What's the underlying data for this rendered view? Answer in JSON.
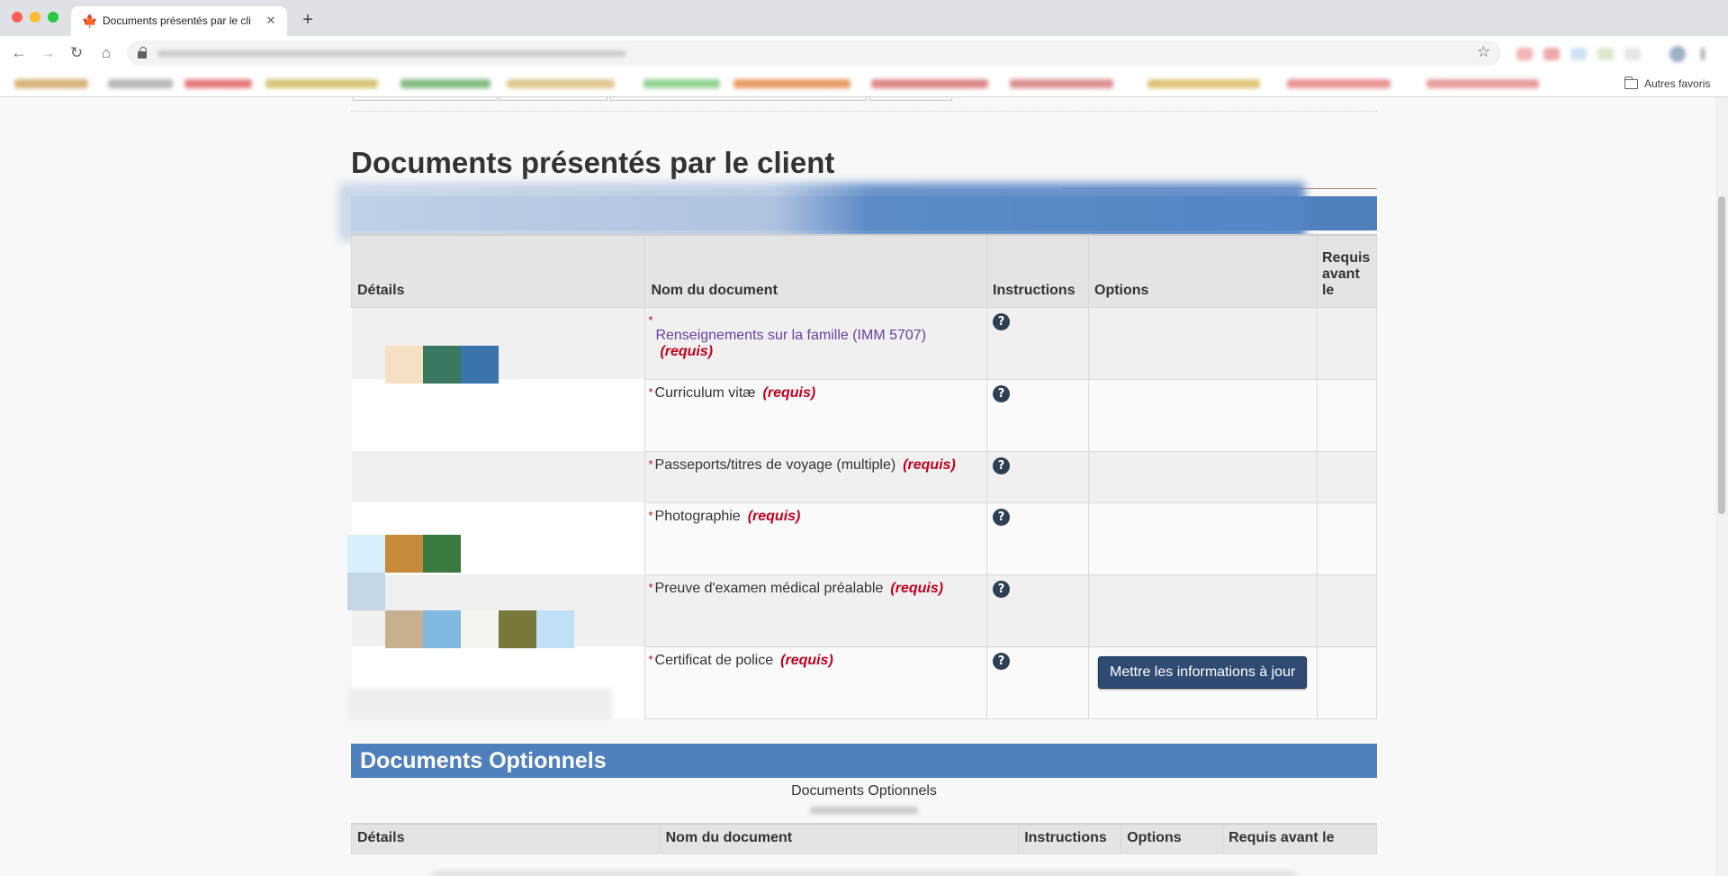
{
  "browser": {
    "tab_title": "Documents présentés par le cli",
    "tab_close": "✕",
    "new_tab": "+",
    "bookmarks_other": "Autres favoris"
  },
  "main": {
    "section_title": "Documents présentés par le client",
    "table": {
      "headers": {
        "details": "Détails",
        "name": "Nom du document",
        "instructions": "Instructions",
        "options": "Options",
        "required_before": "Requis avant le"
      },
      "rows": [
        {
          "star": "*",
          "name": "Renseignements sur la famille (IMM 5707)",
          "required": "(requis)",
          "help": "?",
          "is_link": true
        },
        {
          "star": "*",
          "name": "Curriculum vitæ",
          "required": "(requis)",
          "help": "?"
        },
        {
          "star": "*",
          "name": "Passeports/titres de voyage (multiple)",
          "required": "(requis)",
          "help": "?"
        },
        {
          "star": "*",
          "name": "Photographie",
          "required": "(requis)",
          "help": "?"
        },
        {
          "star": "*",
          "name": "Preuve d'examen médical préalable",
          "required": "(requis)",
          "help": "?"
        },
        {
          "star": "*",
          "name": "Certificat de police",
          "required": "(requis)",
          "help": "?",
          "option_button": "Mettre les informations à jour"
        }
      ]
    }
  },
  "optional": {
    "band_title": "Documents Optionnels",
    "caption": "Documents Optionnels",
    "table": {
      "headers": {
        "details": "Détails",
        "name": "Nom du document",
        "instructions": "Instructions",
        "options": "Options",
        "required_before": "Requis avant le"
      }
    }
  },
  "colors": {
    "band_blue": "#4f7fbd",
    "button_navy": "#2f4b73",
    "required_red": "#c00020",
    "link_purple": "#6a3fa0",
    "pixel_tiles": [
      "#f6e0c4",
      "#3a7860",
      "#3a73ad",
      "#d6effa",
      "#c58a3c",
      "#3a7a3f",
      "#c4d6e6",
      "#c7b08f",
      "#80b8df",
      "#f4f5ef",
      "#78783a",
      "#bfe0f6"
    ]
  },
  "icons": [
    "canada-flag-icon",
    "back-arrow-icon",
    "forward-arrow-icon",
    "reload-icon",
    "home-icon",
    "lock-icon",
    "star-icon",
    "folder-icon",
    "help-icon"
  ]
}
